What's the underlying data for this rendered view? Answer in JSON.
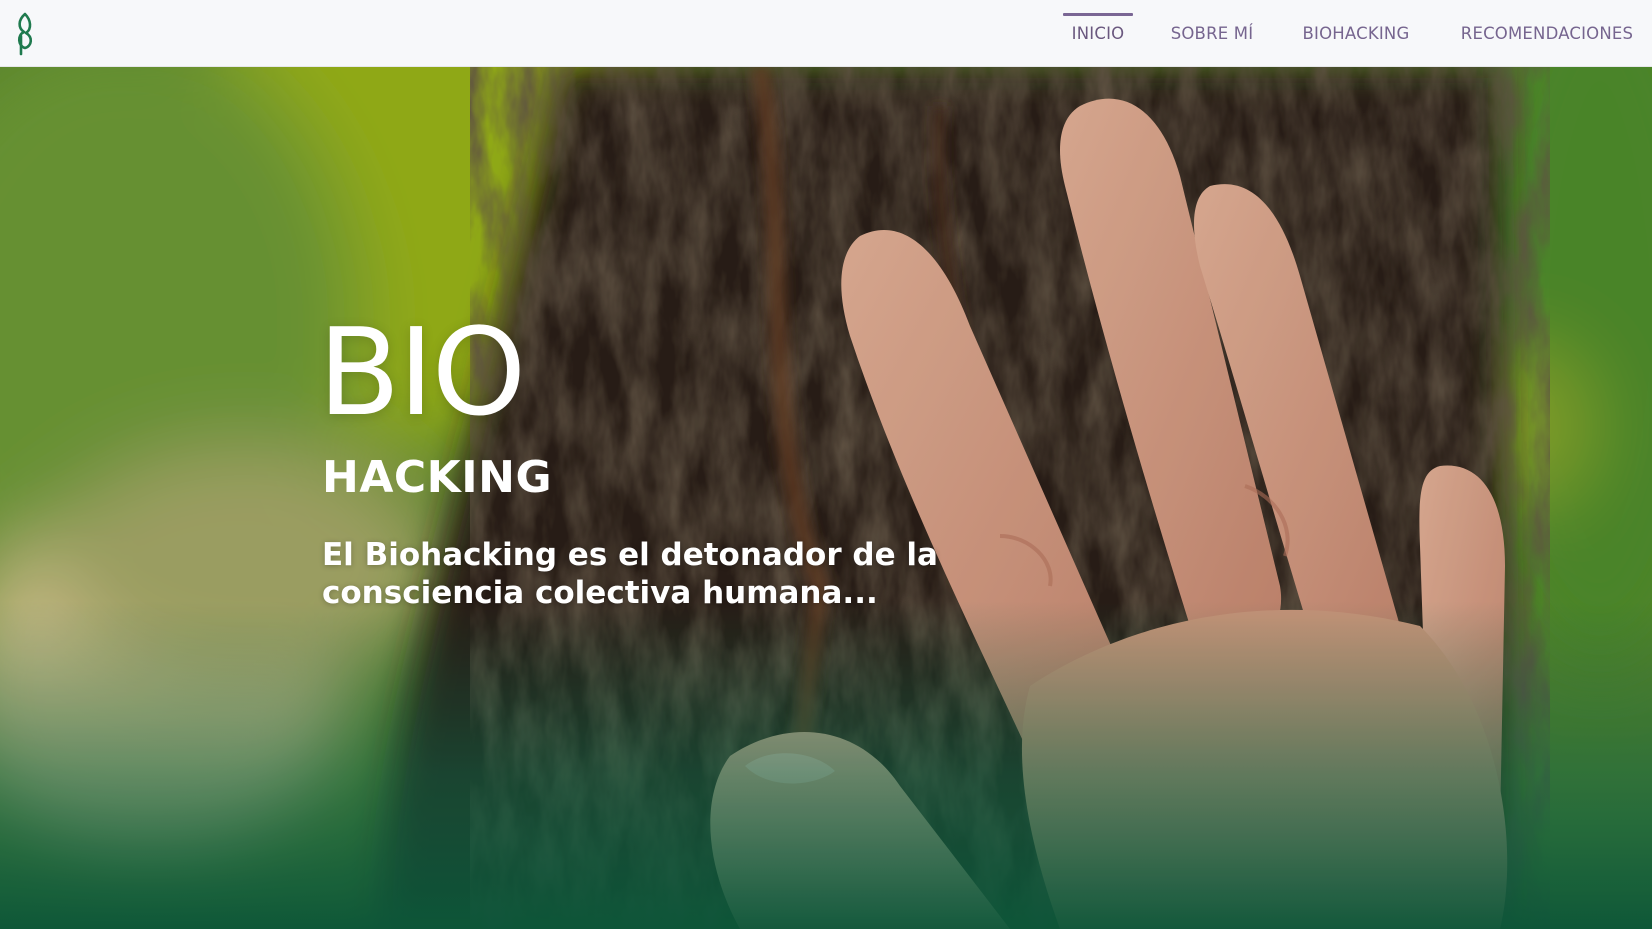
{
  "header": {
    "logo_icon": "leaf-b-logo",
    "nav": [
      {
        "label": "INICIO",
        "active": true
      },
      {
        "label": "SOBRE MÍ",
        "active": false
      },
      {
        "label": "BIOHACKING",
        "active": false
      },
      {
        "label": "RECOMENDACIONES",
        "active": false
      }
    ]
  },
  "hero": {
    "title": "BIO",
    "subtitle": "HACKING",
    "tagline": "El Biohacking es el detonador de la consciencia colectiva humana..."
  },
  "colors": {
    "nav_bg": "#f7f8fa",
    "nav_text": "#76658f",
    "active_indicator": "#7a6694",
    "logo_green": "#1f7a4e",
    "overlay_green": "#11694a"
  }
}
